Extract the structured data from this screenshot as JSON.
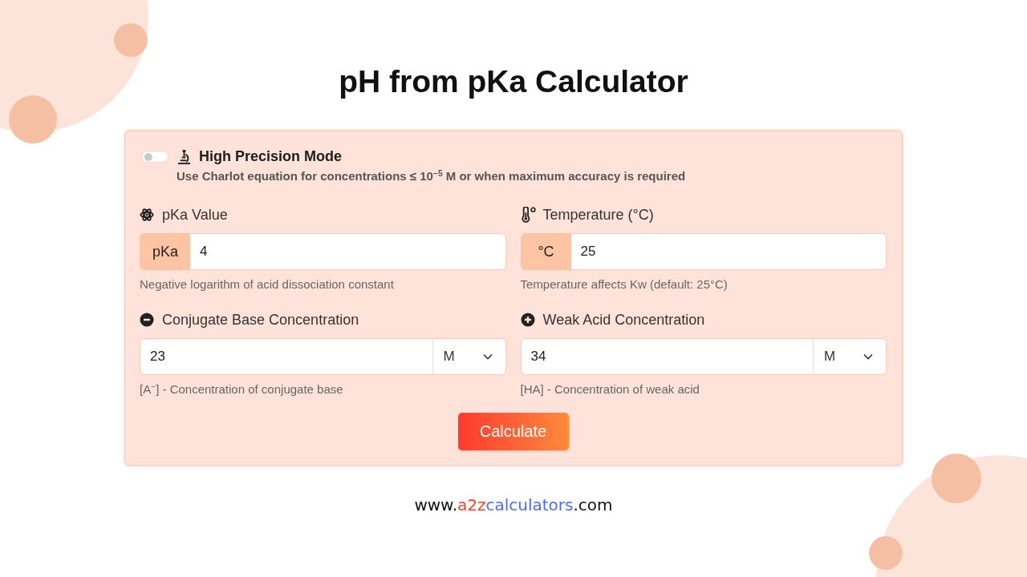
{
  "title": "pH from pKa Calculator",
  "precision": {
    "on": false,
    "label": "High Precision Mode",
    "note": "Use Charlot equation for concentrations ≤ 10$^{−5}$ M or when maximum accuracy is required"
  },
  "fields": [
    {
      "kind": "prefixed",
      "label": "pKa Value",
      "prefix": "pKa",
      "value": "4",
      "hint": "Negative logarithm of acid dissociation constant"
    },
    {
      "kind": "prefixed",
      "label": "Temperature (°C)",
      "prefix": "°C",
      "value": "25",
      "hint": "Temperature affects Kw (default: 25°C)"
    },
    {
      "kind": "unit",
      "label": "Conjugate Base Concentration",
      "value": "23",
      "unit": "M",
      "hint": "[A$^{−}$] - Concentration of conjugate base"
    },
    {
      "kind": "unit",
      "label": "Weak Acid Concentration",
      "value": "34",
      "unit": "M",
      "hint": "[HA] - Concentration of weak acid"
    }
  ],
  "button": "Calculate",
  "footer": [
    {
      "text": "www.",
      "color": "#111111"
    },
    {
      "text": "a2z",
      "color": "#ff3b30"
    },
    {
      "text": "calculators",
      "color": "#4a6cf7"
    },
    {
      "text": ".com",
      "color": "#111111"
    }
  ]
}
